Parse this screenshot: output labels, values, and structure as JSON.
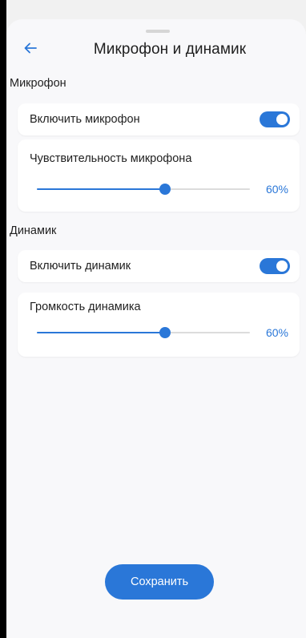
{
  "header": {
    "title": "Микрофон и динамик",
    "back_icon": "arrow-left-icon"
  },
  "microphone": {
    "section_label": "Микрофон",
    "enable_label": "Включить микрофон",
    "enabled": true,
    "sensitivity_label": "Чувствительность микрофона",
    "sensitivity_percent": 60,
    "sensitivity_value_text": "60%"
  },
  "speaker": {
    "section_label": "Динамик",
    "enable_label": "Включить динамик",
    "enabled": true,
    "volume_label": "Громкость динамика",
    "volume_percent": 60,
    "volume_value_text": "60%"
  },
  "footer": {
    "save_label": "Сохранить"
  },
  "colors": {
    "accent": "#2a77d8",
    "background": "#f8f8fa",
    "card": "#ffffff",
    "track": "#dcdcdc"
  }
}
